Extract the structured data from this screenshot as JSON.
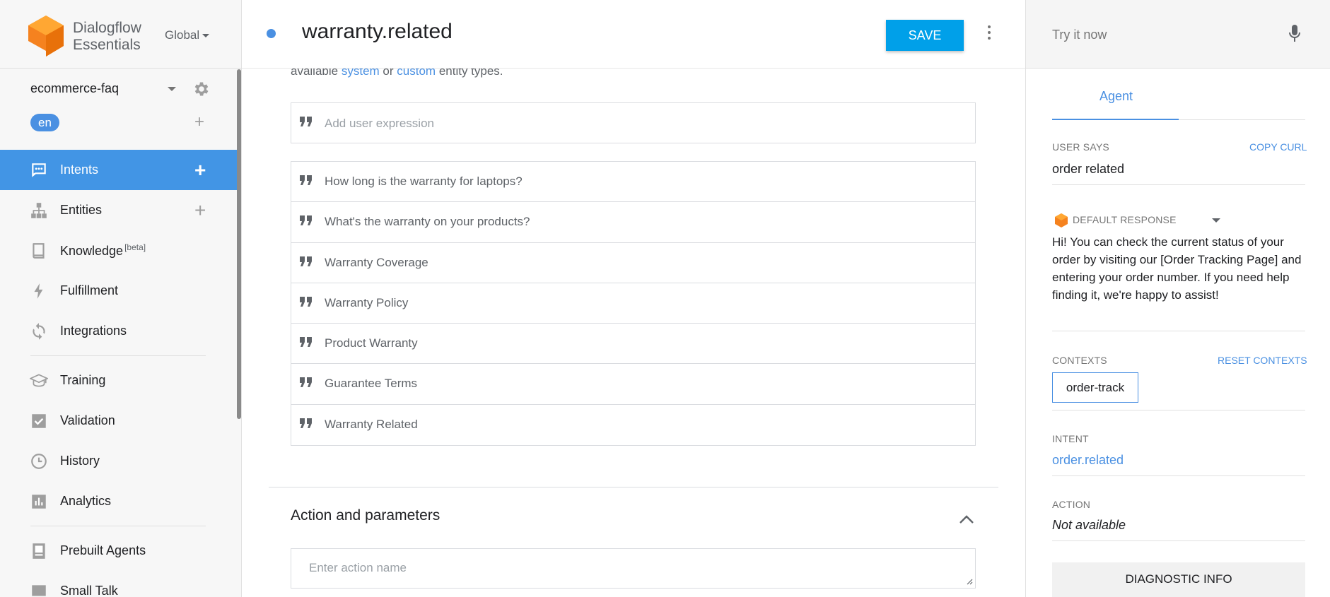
{
  "brand": {
    "line1": "Dialogflow",
    "line2": "Essentials",
    "region": "Global"
  },
  "agent": {
    "name": "ecommerce-faq",
    "language": "en"
  },
  "nav": {
    "intents": "Intents",
    "entities": "Entities",
    "knowledge": "Knowledge",
    "knowledge_badge": "[beta]",
    "fulfillment": "Fulfillment",
    "integrations": "Integrations",
    "training": "Training",
    "validation": "Validation",
    "history": "History",
    "analytics": "Analytics",
    "prebuilt": "Prebuilt Agents",
    "smalltalk": "Small Talk"
  },
  "header": {
    "title": "warranty.related",
    "save": "SAVE"
  },
  "training": {
    "hint_prefix": "available",
    "hint_system": "system",
    "hint_or": "or",
    "hint_custom": "custom",
    "hint_suffix": "entity types.",
    "add_placeholder": "Add user expression",
    "phrases": [
      "How long is the warranty for laptops?",
      "What's the warranty on your products?",
      "Warranty Coverage",
      "Warranty Policy",
      "Product Warranty",
      "Guarantee Terms",
      "Warranty Related"
    ]
  },
  "action_section": {
    "title": "Action and parameters",
    "placeholder": "Enter action name"
  },
  "right_panel": {
    "try_placeholder": "Try it now",
    "tab": "Agent",
    "user_says_label": "USER SAYS",
    "copy_curl": "COPY CURL",
    "user_says_value": "order related",
    "default_response_label": "DEFAULT RESPONSE",
    "default_response_text": "Hi! You can check the current status of your order by visiting our [Order Tracking Page] and entering your order number. If you need help finding it, we're happy to assist!",
    "contexts_label": "CONTEXTS",
    "reset_contexts": "RESET CONTEXTS",
    "context_chip": "order-track",
    "intent_label": "INTENT",
    "intent_value": "order.related",
    "action_label": "ACTION",
    "action_value": "Not available",
    "diagnostic": "DIAGNOSTIC INFO"
  },
  "colors": {
    "accent": "#4295e5",
    "save": "#00a0e9",
    "logo": "#f5821f",
    "link": "#4a90e2"
  }
}
